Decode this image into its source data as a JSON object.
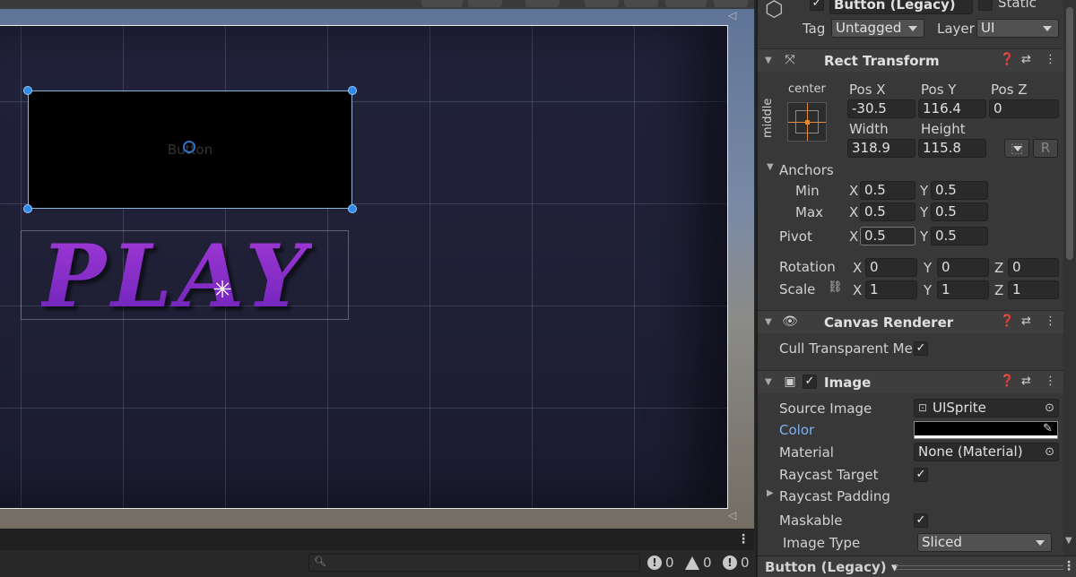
{
  "scene": {
    "button_label": "Button",
    "play_label": "PLAY",
    "search_placeholder": "",
    "error_count": "0",
    "warning_count": "0",
    "message_count": "0"
  },
  "inspector": {
    "object_name": "Button (Legacy)",
    "static_label": "Static",
    "tag_label": "Tag",
    "tag_value": "Untagged",
    "layer_label": "Layer",
    "layer_value": "UI",
    "rect_transform": {
      "title": "Rect Transform",
      "anchor_h": "center",
      "anchor_v": "middle",
      "pos_x_label": "Pos X",
      "pos_y_label": "Pos Y",
      "pos_z_label": "Pos Z",
      "pos_x": "-30.5",
      "pos_y": "116.4",
      "pos_z": "0",
      "width_label": "Width",
      "height_label": "Height",
      "width": "318.9",
      "height": "115.8",
      "r_button": "R",
      "anchors_label": "Anchors",
      "min_label": "Min",
      "max_label": "Max",
      "x_label": "X",
      "y_label": "Y",
      "z_label": "Z",
      "min_x": "0.5",
      "min_y": "0.5",
      "max_x": "0.5",
      "max_y": "0.5",
      "pivot_label": "Pivot",
      "pivot_x": "0.5",
      "pivot_y": "0.5",
      "rotation_label": "Rotation",
      "rot_x": "0",
      "rot_y": "0",
      "rot_z": "0",
      "scale_label": "Scale",
      "scale_x": "1",
      "scale_y": "1",
      "scale_z": "1"
    },
    "canvas_renderer": {
      "title": "Canvas Renderer",
      "cull_label": "Cull Transparent Me:"
    },
    "image": {
      "title": "Image",
      "source_image_label": "Source Image",
      "source_image_value": "UISprite",
      "color_label": "Color",
      "color_value": "#000000",
      "material_label": "Material",
      "material_value": "None (Material)",
      "raycast_target_label": "Raycast Target",
      "raycast_padding_label": "Raycast Padding",
      "maskable_label": "Maskable",
      "image_type_label": "Image Type",
      "image_type_value": "Sliced"
    },
    "footer_label": "Button (Legacy) ▾"
  },
  "colors": {
    "accent_blue": "#2f8bea",
    "play_purple": "#7a1fc0",
    "color_label_blue": "#7fb0f0"
  }
}
